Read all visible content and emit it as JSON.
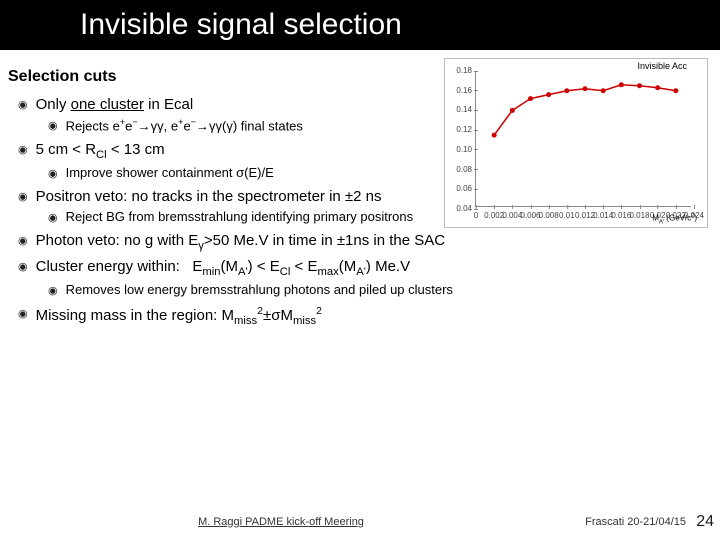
{
  "title": "Invisible signal selection",
  "section_title": "Selection cuts",
  "bullets": {
    "b1": "Only one cluster in Ecal",
    "b1s": "Rejects e⁺e⁻→γγ, e⁺e⁻→γγ(γ) final states",
    "b2": "5 cm < RCl < 13 cm",
    "b2s": "Improve shower containment σ(E)/E",
    "b3": "Positron veto: no tracks in the spectrometer in ±2 ns",
    "b3s": "Reject BG from bremsstrahlung identifying primary positrons",
    "b4": "Photon veto: no g with Eγ>50 Me.V in time in ±1ns in the SAC",
    "b5": "Cluster energy within:   Emin(MA') < ECl < Emax(MA') Me.V",
    "b5s": "Removes low energy bremsstrahlung photons and piled up clusters",
    "b6": "Missing mass in the region: Mmiss²±σMmiss²"
  },
  "footer": {
    "left": "M. Raggi PADME kick-off Meering",
    "date": "Frascati 20-21/04/15",
    "page": "24"
  },
  "chart_data": {
    "type": "line",
    "title": "Invisible Acc",
    "xlabel": "MA' (GeV/c²)",
    "ylabel": "",
    "xlim": [
      0,
      0.024
    ],
    "ylim": [
      0.04,
      0.18
    ],
    "x": [
      0.002,
      0.004,
      0.006,
      0.008,
      0.01,
      0.012,
      0.014,
      0.016,
      0.018,
      0.02,
      0.022
    ],
    "y": [
      0.115,
      0.14,
      0.152,
      0.156,
      0.16,
      0.162,
      0.16,
      0.166,
      0.165,
      0.163,
      0.16
    ],
    "xticks": [
      0,
      0.002,
      0.004,
      0.006,
      0.008,
      0.01,
      0.012,
      0.014,
      0.016,
      0.018,
      0.02,
      0.022,
      0.024
    ],
    "yticks": [
      0.04,
      0.06,
      0.08,
      0.1,
      0.12,
      0.14,
      0.16,
      0.18
    ]
  }
}
